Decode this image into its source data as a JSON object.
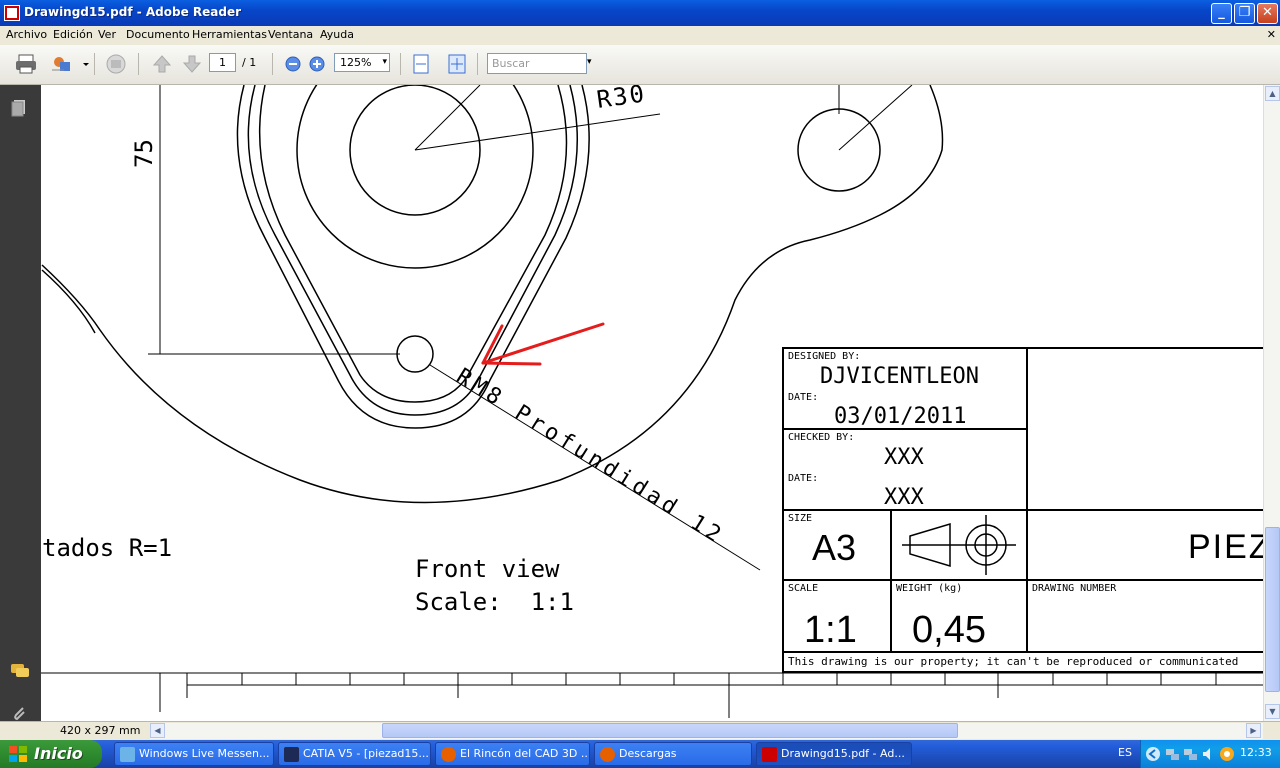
{
  "window": {
    "title": "Drawingd15.pdf - Adobe Reader"
  },
  "menu": {
    "items": [
      "Archivo",
      "Edición",
      "Ver",
      "Documento",
      "Herramientas",
      "Ventana",
      "Ayuda"
    ]
  },
  "toolbar": {
    "page_current": "1",
    "page_total": "/ 1",
    "zoom": "125%",
    "search_placeholder": "Buscar"
  },
  "status": {
    "page_size": "420 x 297 mm"
  },
  "drawing": {
    "dim_radius": "R30",
    "dim_height": "75",
    "thread_note": "RM8 Profundidad 12",
    "rounding_note": "tados R=1",
    "view_label": "Front view",
    "view_scale": "Scale:  1:1"
  },
  "title_block": {
    "designed_by_label": "DESIGNED BY:",
    "designed_by": "DJVICENTLEON",
    "date1_label": "DATE:",
    "date1": "03/01/2011",
    "checked_by_label": "CHECKED BY:",
    "checked_by": "XXX",
    "date2_label": "DATE:",
    "date2": "XXX",
    "size_label": "SIZE",
    "size": "A3",
    "part_title": "PIEZ",
    "scale_label": "SCALE",
    "scale": "1:1",
    "weight_label": "WEIGHT (kg)",
    "weight": "0,45",
    "drawing_number_label": "DRAWING NUMBER",
    "property_note": "This drawing is our property; it can't be reproduced or communicated"
  },
  "taskbar": {
    "start": "Inicio",
    "tasks": [
      "Windows Live Messen...",
      "CATIA V5 - [piezad15....",
      "El Rincón del CAD 3D ...",
      "Descargas",
      "Drawingd15.pdf - Ad..."
    ],
    "lang": "ES",
    "clock": "12:33"
  },
  "colors": {
    "annotation_arrow": "#e51c1c",
    "title_bar": "#0a5fe0",
    "taskbar": "#245edb"
  }
}
